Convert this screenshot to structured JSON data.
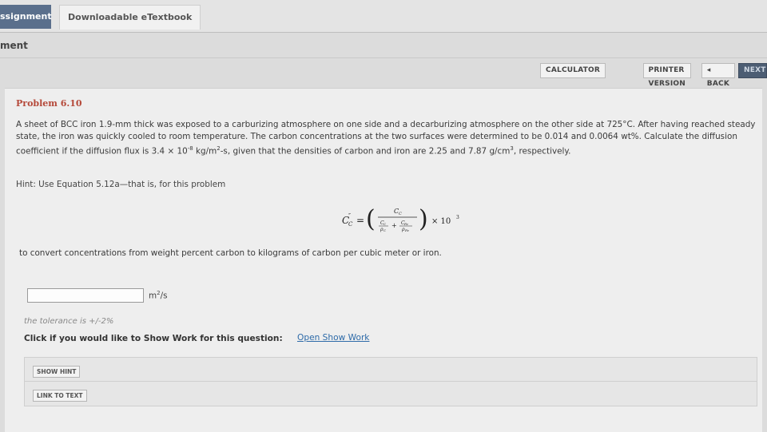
{
  "tabs": {
    "assignment": "ssignment",
    "etextbook": "Downloadable eTextbook"
  },
  "section_label": "ment",
  "toolbar": {
    "calculator": "CALCULATOR",
    "printer_version": "PRINTER VERSION",
    "back": "◂ BACK",
    "next": "NEXT"
  },
  "problem": {
    "title": "Problem 6.10",
    "text_part1": "A sheet of BCC iron 1.9-mm thick was exposed to a carburizing atmosphere on one side and a decarburizing atmosphere on the other side at 725°C. After having reached steady state, the iron was quickly cooled to room temperature. The carbon concentrations at the two surfaces were determined to be 0.014 and 0.0064 wt%. Calculate the diffusion coefficient if the diffusion flux is 3.4 × 10",
    "flux_exp": "-8",
    "text_part2": " kg/m",
    "area_exp": "2",
    "text_part3": "-s, given that the densities of carbon and iron are 2.25 and 7.87 g/cm",
    "vol_exp": "3",
    "text_part4": ", respectively.",
    "hint": "Hint: Use Equation 5.12a—that is, for this problem",
    "convert_text": "to convert concentrations from weight percent carbon to kilograms of carbon per cubic meter or iron."
  },
  "equation": {
    "lhs": "C",
    "lhs_sup": "″",
    "lhs_sub": "C",
    "equals": "=",
    "num": "C",
    "num_sub": "C",
    "den1": "C",
    "den1_sub": "C",
    "den1_rho": "ρ",
    "den1_rho_sub": "C",
    "plus": "+",
    "den2": "C",
    "den2_sub": "Fe",
    "den2_rho": "ρ",
    "den2_rho_sub": "Fe",
    "times": "× 10",
    "times_exp": "3"
  },
  "answer": {
    "value": "",
    "unit_base": "m",
    "unit_exp": "2",
    "unit_tail": "/s"
  },
  "tolerance": "the tolerance is +/-2%",
  "show_work": {
    "label": "Click if you would like to Show Work for this question:",
    "link": "Open Show Work"
  },
  "buttons": {
    "show_hint": "SHOW HINT",
    "link_to_text": "LINK TO TEXT"
  }
}
